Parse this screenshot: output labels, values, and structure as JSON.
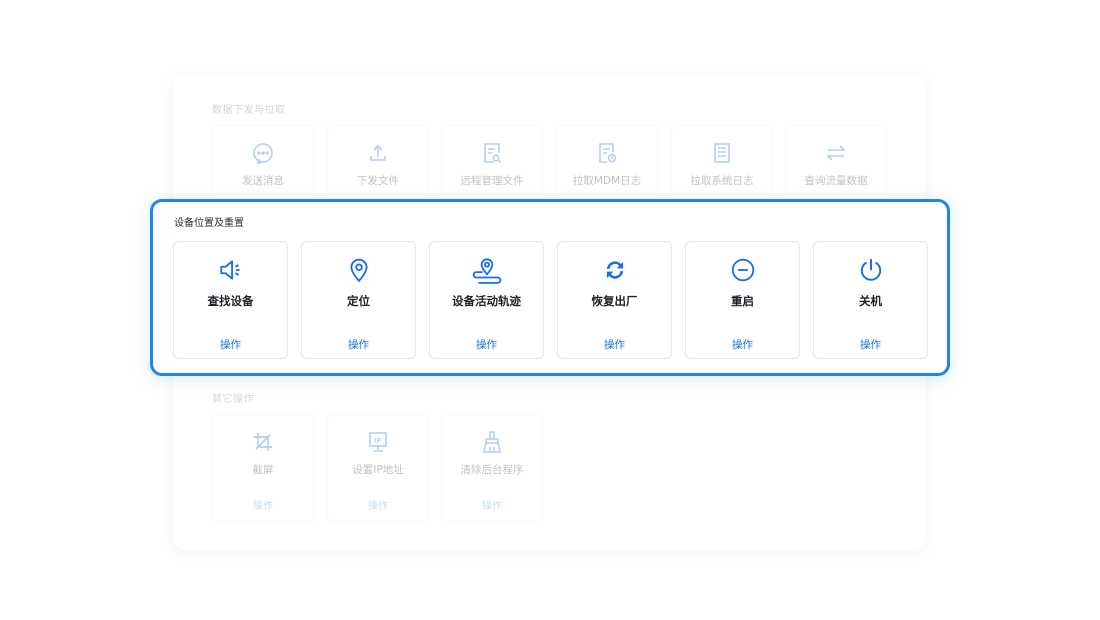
{
  "sections": {
    "data_transfer": {
      "title": "数据下发与拉取",
      "items": [
        {
          "label": "发送消息",
          "icon": "chat-bubble-icon"
        },
        {
          "label": "下发文件",
          "icon": "upload-icon"
        },
        {
          "label": "远程管理文件",
          "icon": "file-search-icon"
        },
        {
          "label": "拉取MDM日志",
          "icon": "log-clock-icon"
        },
        {
          "label": "拉取系统日志",
          "icon": "document-lines-icon"
        },
        {
          "label": "查询流量数据",
          "icon": "swap-arrows-icon"
        }
      ]
    },
    "device_location": {
      "title": "设备位置及重置",
      "action_label": "操作",
      "items": [
        {
          "label": "查找设备",
          "icon": "speaker-icon"
        },
        {
          "label": "定位",
          "icon": "location-pin-icon"
        },
        {
          "label": "设备活动轨迹",
          "icon": "track-pin-icon"
        },
        {
          "label": "恢复出厂",
          "icon": "refresh-icon"
        },
        {
          "label": "重启",
          "icon": "minus-circle-icon"
        },
        {
          "label": "关机",
          "icon": "power-icon"
        }
      ]
    },
    "other": {
      "title": "其它操作",
      "action_label": "操作",
      "items": [
        {
          "label": "截屏",
          "icon": "crop-icon"
        },
        {
          "label": "设置IP地址",
          "icon": "ip-monitor-icon"
        },
        {
          "label": "清除后台程序",
          "icon": "brush-icon"
        }
      ]
    }
  },
  "colors": {
    "accent": "#1d86e8",
    "action_text": "#1d6fe0",
    "icon_blue": "#1a6ee3"
  }
}
